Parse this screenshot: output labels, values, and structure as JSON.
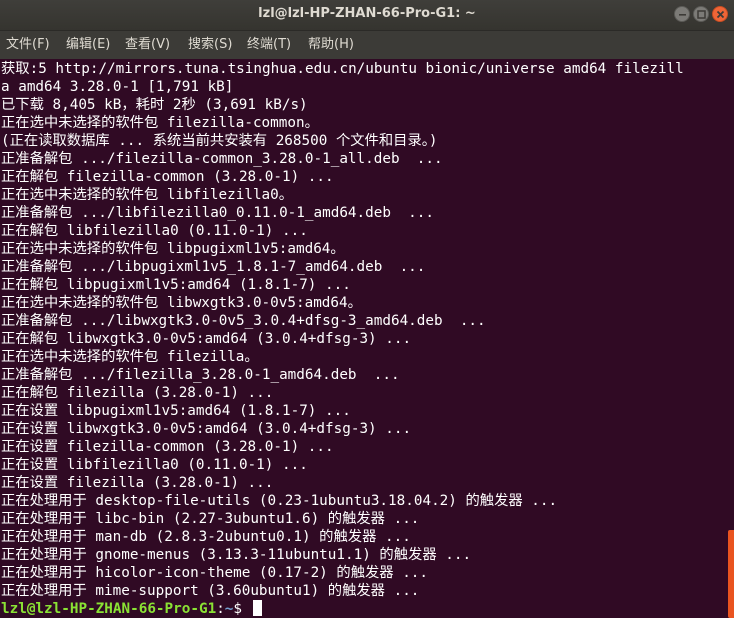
{
  "window": {
    "title": "lzl@lzl-HP-ZHAN-66-Pro-G1: ~",
    "buttons": [
      "minimize-icon",
      "maximize-icon",
      "close-icon"
    ]
  },
  "menubar": {
    "items": [
      "文件(F)",
      "编辑(E)",
      "查看(V)",
      "搜索(S)",
      "终端(T)",
      "帮助(H)"
    ]
  },
  "terminal": {
    "lines": [
      "获取:5 http://mirrors.tuna.tsinghua.edu.cn/ubuntu bionic/universe amd64 filezill",
      "a amd64 3.28.0-1 [1,791 kB]",
      "已下载 8,405 kB，耗时 2秒 (3,691 kB/s)",
      "正在选中未选择的软件包 filezilla-common。",
      "(正在读取数据库 ... 系统当前共安装有 268500 个文件和目录。)",
      "正准备解包 .../filezilla-common_3.28.0-1_all.deb  ...",
      "正在解包 filezilla-common (3.28.0-1) ...",
      "正在选中未选择的软件包 libfilezilla0。",
      "正准备解包 .../libfilezilla0_0.11.0-1_amd64.deb  ...",
      "正在解包 libfilezilla0 (0.11.0-1) ...",
      "正在选中未选择的软件包 libpugixml1v5:amd64。",
      "正准备解包 .../libpugixml1v5_1.8.1-7_amd64.deb  ...",
      "正在解包 libpugixml1v5:amd64 (1.8.1-7) ...",
      "正在选中未选择的软件包 libwxgtk3.0-0v5:amd64。",
      "正准备解包 .../libwxgtk3.0-0v5_3.0.4+dfsg-3_amd64.deb  ...",
      "正在解包 libwxgtk3.0-0v5:amd64 (3.0.4+dfsg-3) ...",
      "正在选中未选择的软件包 filezilla。",
      "正准备解包 .../filezilla_3.28.0-1_amd64.deb  ...",
      "正在解包 filezilla (3.28.0-1) ...",
      "正在设置 libpugixml1v5:amd64 (1.8.1-7) ...",
      "正在设置 libwxgtk3.0-0v5:amd64 (3.0.4+dfsg-3) ...",
      "正在设置 filezilla-common (3.28.0-1) ...",
      "正在设置 libfilezilla0 (0.11.0-1) ...",
      "正在设置 filezilla (3.28.0-1) ...",
      "正在处理用于 desktop-file-utils (0.23-1ubuntu3.18.04.2) 的触发器 ...",
      "正在处理用于 libc-bin (2.27-3ubuntu1.6) 的触发器 ...",
      "正在处理用于 man-db (2.8.3-2ubuntu0.1) 的触发器 ...",
      "正在处理用于 gnome-menus (3.13.3-11ubuntu1.1) 的触发器 ...",
      "正在处理用于 hicolor-icon-theme (0.17-2) 的触发器 ...",
      "正在处理用于 mime-support (3.60ubuntu1) 的触发器 ..."
    ],
    "prompt": {
      "user_host": "lzl@lzl-HP-ZHAN-66-Pro-G1",
      "separator": ":",
      "path": "~",
      "symbol": "$ "
    }
  },
  "colors": {
    "background": "#300a24",
    "text": "#ffffff",
    "prompt_user": "#8ae234",
    "prompt_path": "#729fcf",
    "scrollbar": "#e95420",
    "titlebar": "#3c3b37"
  }
}
